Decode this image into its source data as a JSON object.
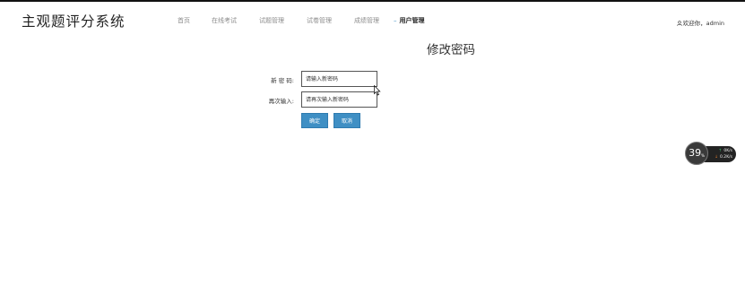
{
  "header": {
    "app_title": "主观题评分系统",
    "welcome_text": "欢迎你，admin"
  },
  "nav": {
    "items": [
      {
        "label": "首页",
        "active": false
      },
      {
        "label": "在线考试",
        "active": false
      },
      {
        "label": "试题管理",
        "active": false
      },
      {
        "label": "试卷管理",
        "active": false
      },
      {
        "label": "成绩管理",
        "active": false
      },
      {
        "label": "用户管理",
        "active": true
      }
    ]
  },
  "page": {
    "title": "修改密码"
  },
  "form": {
    "new_password_label": "新 密 码:",
    "new_password_placeholder": "请输入新密码",
    "confirm_label": "再次输入:",
    "confirm_placeholder": "请再次输入新密码",
    "confirm_button": "确定",
    "cancel_button": "取消"
  },
  "net_widget": {
    "percent": "39",
    "percent_unit": "%",
    "upload": "0",
    "upload_unit": "K/s",
    "download": "0.2",
    "download_unit": "K/s"
  },
  "colors": {
    "accent": "#3f8fc4",
    "nav_inactive": "#8c8c8c"
  }
}
